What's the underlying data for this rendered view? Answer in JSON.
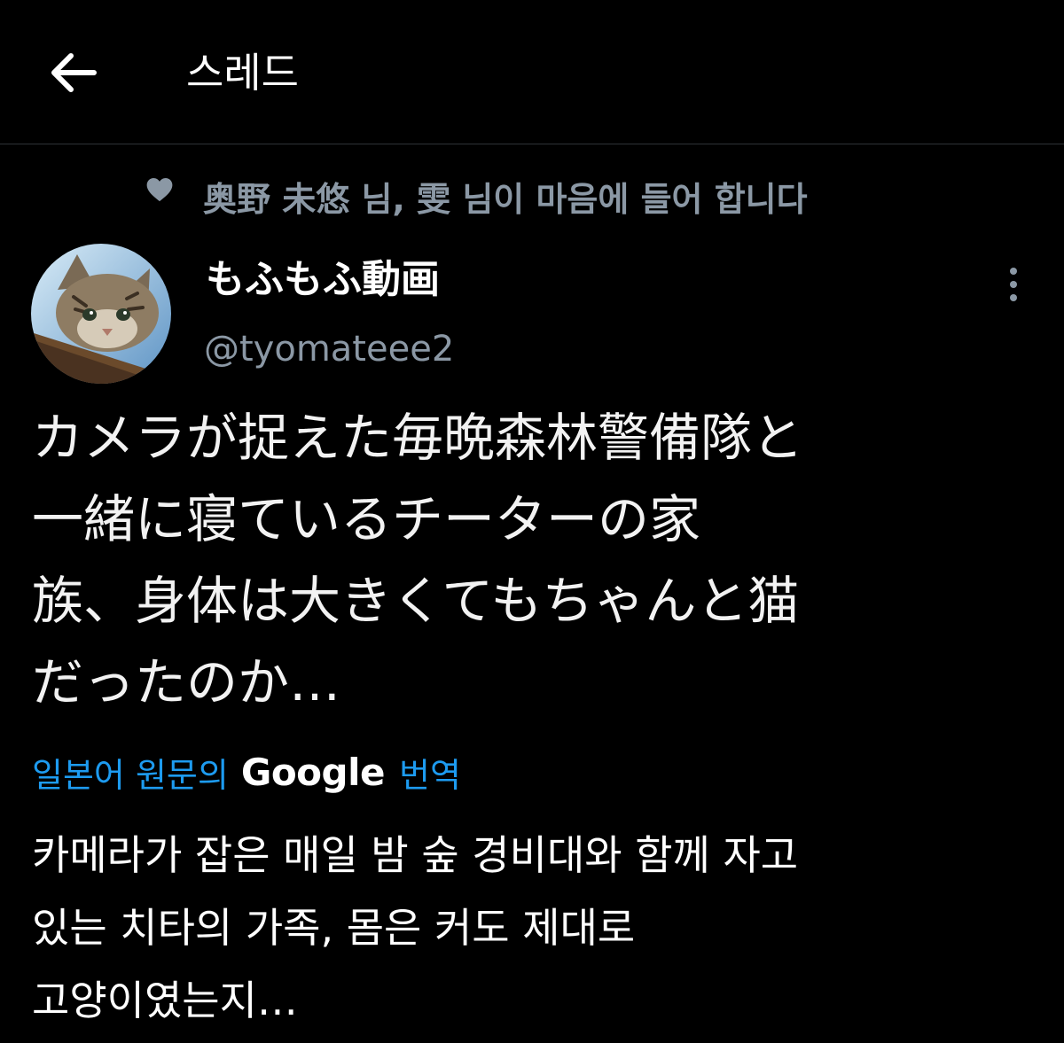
{
  "header": {
    "back_icon": "arrow-left-icon",
    "title": "스레드"
  },
  "social_context": {
    "icon": "heart-icon",
    "text": "奥野 未悠 님, 雯 님이 마음에 들어 합니다"
  },
  "tweet": {
    "author": {
      "display_name": "もふもふ動画",
      "handle": "@tyomateee2",
      "avatar_icon": "cat-avatar"
    },
    "more_icon": "more-vertical-icon",
    "text": "カメラが捉えた毎晩森林警備隊と\n一緒に寝ているチーターの家\n族、身体は大きくてもちゃんと猫\nだったのか…",
    "translation": {
      "prefix": "일본어 원문의",
      "brand": "Google",
      "suffix": "번역",
      "text": "카메라가 잡은 매일 밤 숲 경비대와 함께 자고\n있는 치타의 가족, 몸은 커도 제대로\n고양이였는지…"
    }
  },
  "colors": {
    "background": "#000000",
    "primary_text": "#e7e9ea",
    "secondary_text": "#8b98a5",
    "link": "#1d9bf0",
    "divider": "#2f3336"
  }
}
